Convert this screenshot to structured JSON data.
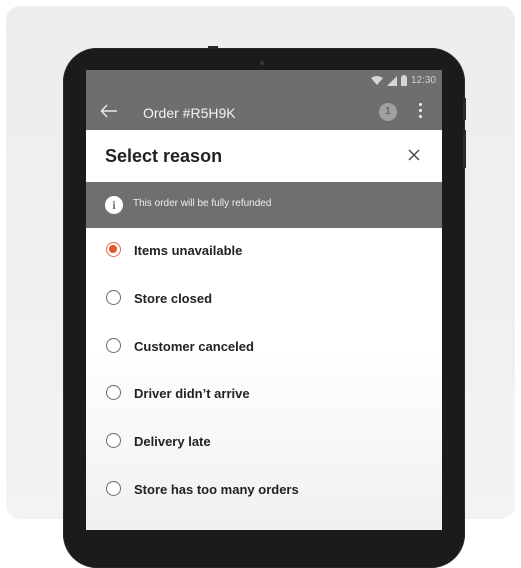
{
  "status_bar": {
    "time": "12:30",
    "wifi_icon": "wifi-icon",
    "signal_icon": "signal-icon",
    "battery_icon": "battery-icon"
  },
  "app_bar": {
    "back_icon": "arrow-left-icon",
    "title": "Order #R5H9K",
    "badge_count": "1",
    "more_icon": "more-vertical-icon"
  },
  "sheet": {
    "title": "Select reason",
    "close_icon": "close-icon",
    "notice": {
      "icon": "info-icon",
      "glyph": "i",
      "text": "This order will be fully refunded"
    },
    "options": [
      {
        "label": "Items unavailable",
        "selected": true
      },
      {
        "label": "Store closed",
        "selected": false
      },
      {
        "label": "Customer canceled",
        "selected": false
      },
      {
        "label": "Driver didn’t arrive",
        "selected": false
      },
      {
        "label": "Delivery late",
        "selected": false
      },
      {
        "label": "Store has too many orders",
        "selected": false
      }
    ]
  },
  "colors": {
    "accent": "#e4572e",
    "overlay": "#6e6e6e",
    "sheet_bg": "#ffffff"
  }
}
